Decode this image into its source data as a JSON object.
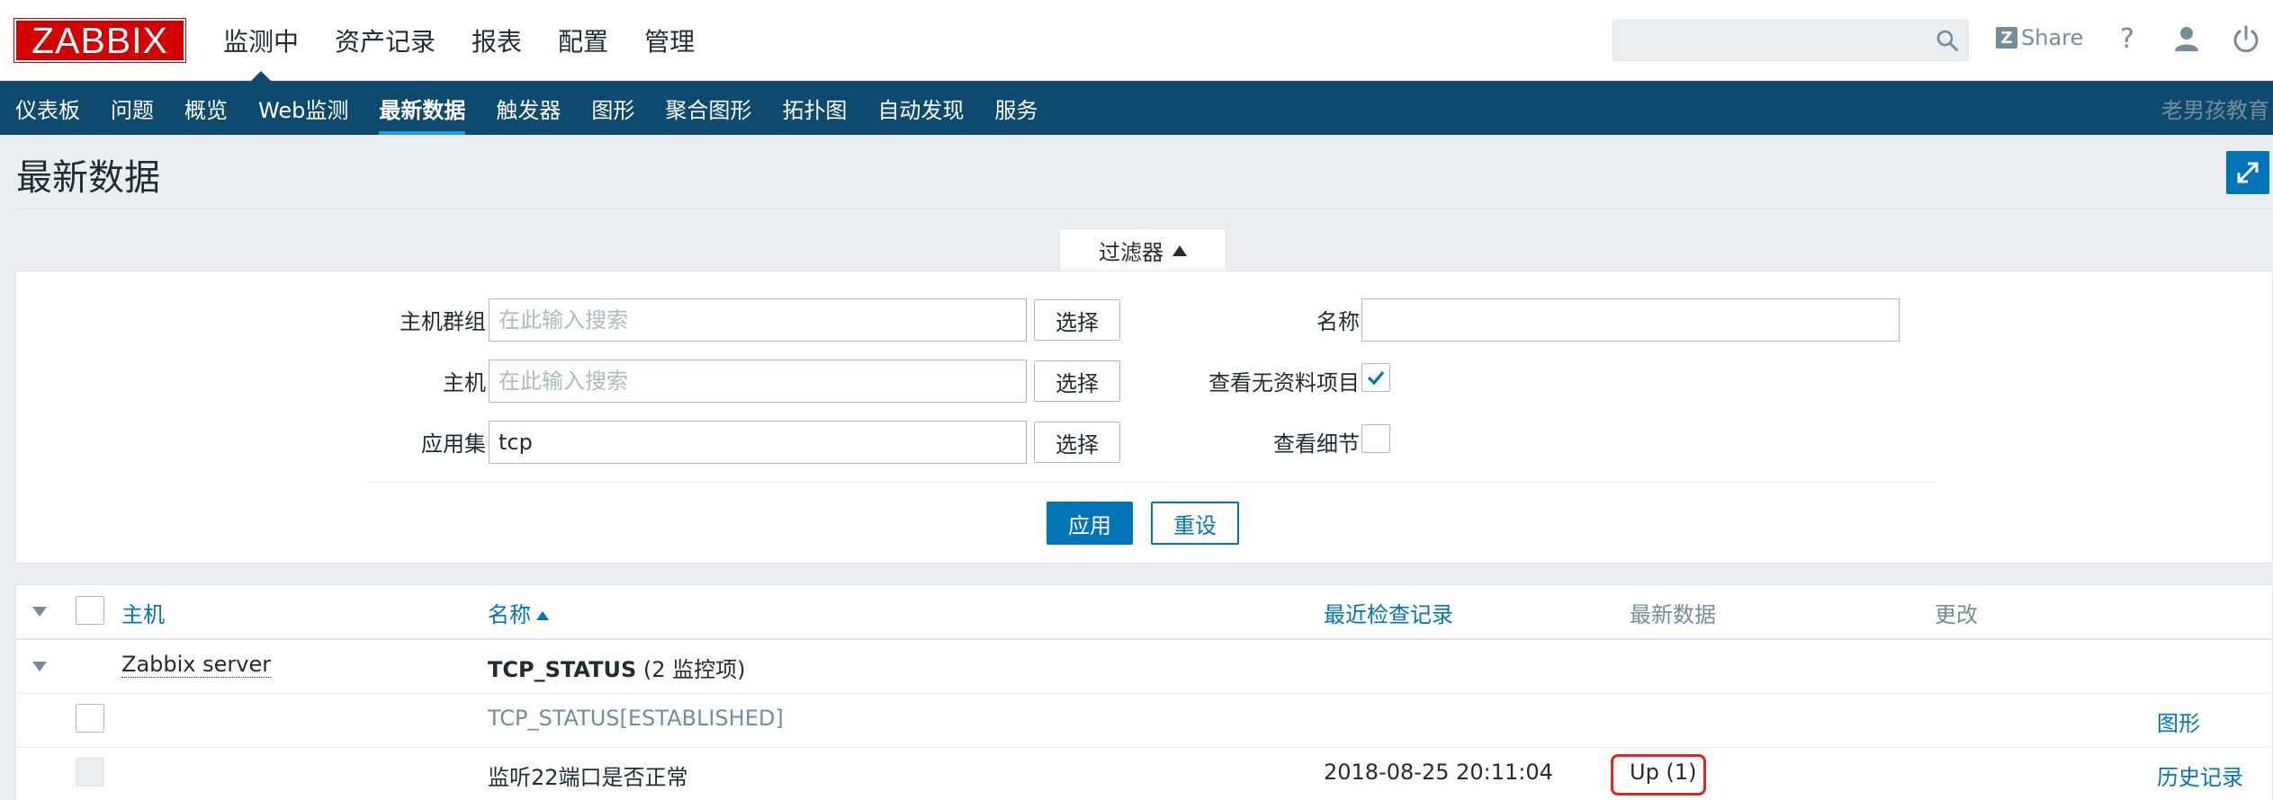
{
  "header": {
    "logo": "ZABBIX",
    "main_menu": [
      "监测中",
      "资产记录",
      "报表",
      "配置",
      "管理"
    ],
    "search": {
      "value": "",
      "placeholder": ""
    },
    "share_label": "Share",
    "help_label": "?"
  },
  "sub_menu": {
    "items": [
      "仪表板",
      "问题",
      "概览",
      "Web监测",
      "最新数据",
      "触发器",
      "图形",
      "聚合图形",
      "拓扑图",
      "自动发现",
      "服务"
    ],
    "active": "最新数据",
    "right_text": "老男孩教育"
  },
  "page": {
    "title": "最新数据"
  },
  "filter": {
    "tab_label": "过滤器",
    "host_groups": {
      "label": "主机群组",
      "value": "",
      "placeholder": "在此输入搜索",
      "button": "选择"
    },
    "hosts": {
      "label": "主机",
      "value": "",
      "placeholder": "在此输入搜索",
      "button": "选择"
    },
    "application": {
      "label": "应用集",
      "value": "tcp",
      "button": "选择"
    },
    "name": {
      "label": "名称",
      "value": ""
    },
    "show_without_data": {
      "label": "查看无资料项目",
      "checked": true
    },
    "show_details": {
      "label": "查看细节",
      "checked": false
    },
    "apply_label": "应用",
    "reset_label": "重设"
  },
  "table": {
    "columns": {
      "host": "主机",
      "name": "名称",
      "last_check": "最近检查记录",
      "last_value": "最新数据",
      "change": "更改"
    },
    "host_row": {
      "host": "Zabbix server",
      "app_name": "TCP_STATUS",
      "app_count": "(2 监控项)"
    },
    "rows": [
      {
        "name": "TCP_STATUS[ESTABLISHED]",
        "last_check": "",
        "last_value": "",
        "change": "",
        "link": "图形"
      },
      {
        "name": "监听22端口是否正常",
        "last_check": "2018-08-25 20:11:04",
        "last_value": "Up (1)",
        "change": "",
        "link": "历史记录"
      }
    ]
  },
  "colors": {
    "brand_red": "#d40000",
    "nav_blue": "#0e4a6e",
    "link_blue": "#0275b8",
    "highlight_red": "#e8221b"
  }
}
